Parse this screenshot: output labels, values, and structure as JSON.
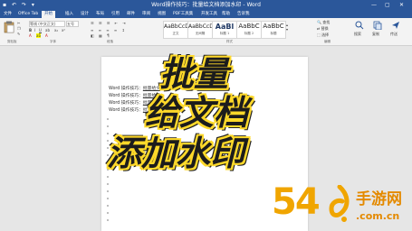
{
  "window": {
    "title": "Word操作技巧：批量给文档添加水印 - Word",
    "minimize": "—",
    "maximize": "▢",
    "close": "✕"
  },
  "tabs": [
    "文件",
    "Office Tab",
    "开始",
    "插入",
    "设计",
    "布局",
    "引用",
    "邮件",
    "审阅",
    "视图",
    "PDF工具集",
    "开发工具",
    "帮助",
    "告诉我"
  ],
  "active_tab_index": 2,
  "ribbon": {
    "font_name": "等线 (中文正文)",
    "font_size": "五号",
    "styles": [
      {
        "preview": "AaBbCcDd",
        "name": "正文"
      },
      {
        "preview": "AaBbCcDd",
        "name": "无间隔"
      },
      {
        "preview": "AaBl",
        "name": "标题 1"
      },
      {
        "preview": "AaBbC",
        "name": "标题 2"
      },
      {
        "preview": "AaBbC",
        "name": "标题"
      }
    ],
    "groups": [
      "剪贴板",
      "字体",
      "段落",
      "样式",
      "编辑"
    ],
    "right_items": [
      "查找",
      "替换",
      "选择",
      "搜索",
      "复制",
      "传送"
    ]
  },
  "document": {
    "lines": [
      {
        "prefix": "Word 操作技巧：",
        "link": "批量给文"
      },
      {
        "prefix": "Word 操作技巧：",
        "link": "批量给文"
      },
      {
        "prefix": "Word 操作技巧：",
        "link": "批量"
      },
      {
        "prefix": "Word 操作技巧：",
        "link": "批量"
      }
    ]
  },
  "overlay": {
    "line1": "批量",
    "line2": "给文档",
    "line3": "添加水印"
  },
  "watermark": {
    "number": "54",
    "brand": "手游网",
    "domain": ".com.cn"
  }
}
